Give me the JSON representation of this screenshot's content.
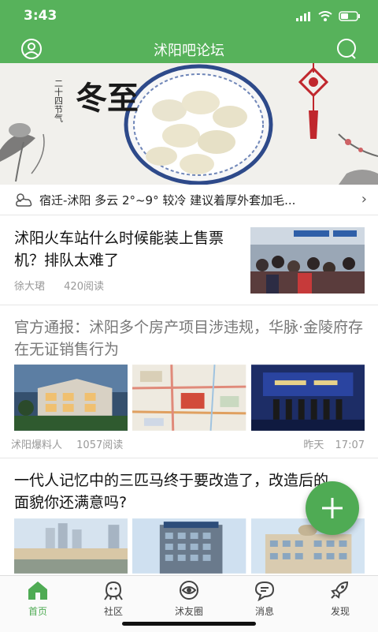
{
  "status_bar": {
    "time": "3:43"
  },
  "header": {
    "title": "沭阳吧论坛",
    "left_icon": "user-icon",
    "right_icon": "search-icon"
  },
  "banner": {
    "heading": "冬至",
    "subheading": "二十四节气"
  },
  "weather": {
    "text": "宿迁-沭阳 多云 2°~9° 较冷 建议着厚外套加毛...",
    "icon": "cloud-sun-icon"
  },
  "articles": [
    {
      "title": "沭阳火车站什么时候能装上售票机？排队太难了",
      "author": "徐大珺",
      "reads": "420阅读"
    },
    {
      "title": "官方通报：沭阳多个房产项目涉违规，华脉·金陵府存在无证销售行为",
      "author": "沭阳爆料人",
      "reads": "1057阅读",
      "date": "昨天",
      "time": "17:07"
    },
    {
      "title": "一代人记忆中的三匹马终于要改造了，改造后的面貌你还满意吗?"
    }
  ],
  "fab": {
    "icon": "plus-icon"
  },
  "tabs": [
    {
      "label": "首页",
      "icon": "home-icon",
      "active": true
    },
    {
      "label": "社区",
      "icon": "community-icon"
    },
    {
      "label": "沭友圈",
      "icon": "eye-circle-icon"
    },
    {
      "label": "消息",
      "icon": "message-icon"
    },
    {
      "label": "发现",
      "icon": "rocket-icon"
    }
  ],
  "colors": {
    "brand_green": "#57b25b",
    "fab_green": "#4fab54",
    "muted_text": "#999999"
  }
}
